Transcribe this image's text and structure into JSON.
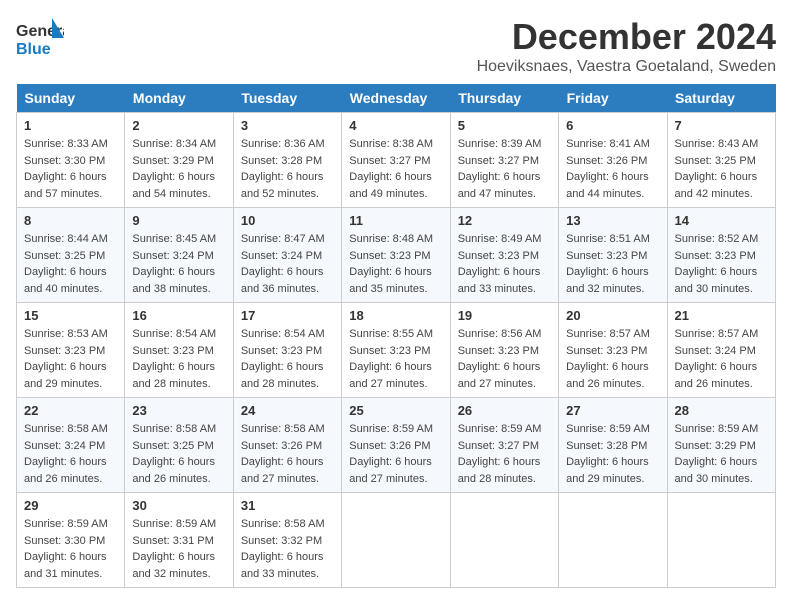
{
  "header": {
    "logo_line1": "General",
    "logo_line2": "Blue",
    "month": "December 2024",
    "location": "Hoeviksnaes, Vaestra Goetaland, Sweden"
  },
  "days_of_week": [
    "Sunday",
    "Monday",
    "Tuesday",
    "Wednesday",
    "Thursday",
    "Friday",
    "Saturday"
  ],
  "weeks": [
    [
      {
        "day": "1",
        "sunrise": "8:33 AM",
        "sunset": "3:30 PM",
        "daylight": "6 hours and 57 minutes."
      },
      {
        "day": "2",
        "sunrise": "8:34 AM",
        "sunset": "3:29 PM",
        "daylight": "6 hours and 54 minutes."
      },
      {
        "day": "3",
        "sunrise": "8:36 AM",
        "sunset": "3:28 PM",
        "daylight": "6 hours and 52 minutes."
      },
      {
        "day": "4",
        "sunrise": "8:38 AM",
        "sunset": "3:27 PM",
        "daylight": "6 hours and 49 minutes."
      },
      {
        "day": "5",
        "sunrise": "8:39 AM",
        "sunset": "3:27 PM",
        "daylight": "6 hours and 47 minutes."
      },
      {
        "day": "6",
        "sunrise": "8:41 AM",
        "sunset": "3:26 PM",
        "daylight": "6 hours and 44 minutes."
      },
      {
        "day": "7",
        "sunrise": "8:43 AM",
        "sunset": "3:25 PM",
        "daylight": "6 hours and 42 minutes."
      }
    ],
    [
      {
        "day": "8",
        "sunrise": "8:44 AM",
        "sunset": "3:25 PM",
        "daylight": "6 hours and 40 minutes."
      },
      {
        "day": "9",
        "sunrise": "8:45 AM",
        "sunset": "3:24 PM",
        "daylight": "6 hours and 38 minutes."
      },
      {
        "day": "10",
        "sunrise": "8:47 AM",
        "sunset": "3:24 PM",
        "daylight": "6 hours and 36 minutes."
      },
      {
        "day": "11",
        "sunrise": "8:48 AM",
        "sunset": "3:23 PM",
        "daylight": "6 hours and 35 minutes."
      },
      {
        "day": "12",
        "sunrise": "8:49 AM",
        "sunset": "3:23 PM",
        "daylight": "6 hours and 33 minutes."
      },
      {
        "day": "13",
        "sunrise": "8:51 AM",
        "sunset": "3:23 PM",
        "daylight": "6 hours and 32 minutes."
      },
      {
        "day": "14",
        "sunrise": "8:52 AM",
        "sunset": "3:23 PM",
        "daylight": "6 hours and 30 minutes."
      }
    ],
    [
      {
        "day": "15",
        "sunrise": "8:53 AM",
        "sunset": "3:23 PM",
        "daylight": "6 hours and 29 minutes."
      },
      {
        "day": "16",
        "sunrise": "8:54 AM",
        "sunset": "3:23 PM",
        "daylight": "6 hours and 28 minutes."
      },
      {
        "day": "17",
        "sunrise": "8:54 AM",
        "sunset": "3:23 PM",
        "daylight": "6 hours and 28 minutes."
      },
      {
        "day": "18",
        "sunrise": "8:55 AM",
        "sunset": "3:23 PM",
        "daylight": "6 hours and 27 minutes."
      },
      {
        "day": "19",
        "sunrise": "8:56 AM",
        "sunset": "3:23 PM",
        "daylight": "6 hours and 27 minutes."
      },
      {
        "day": "20",
        "sunrise": "8:57 AM",
        "sunset": "3:23 PM",
        "daylight": "6 hours and 26 minutes."
      },
      {
        "day": "21",
        "sunrise": "8:57 AM",
        "sunset": "3:24 PM",
        "daylight": "6 hours and 26 minutes."
      }
    ],
    [
      {
        "day": "22",
        "sunrise": "8:58 AM",
        "sunset": "3:24 PM",
        "daylight": "6 hours and 26 minutes."
      },
      {
        "day": "23",
        "sunrise": "8:58 AM",
        "sunset": "3:25 PM",
        "daylight": "6 hours and 26 minutes."
      },
      {
        "day": "24",
        "sunrise": "8:58 AM",
        "sunset": "3:26 PM",
        "daylight": "6 hours and 27 minutes."
      },
      {
        "day": "25",
        "sunrise": "8:59 AM",
        "sunset": "3:26 PM",
        "daylight": "6 hours and 27 minutes."
      },
      {
        "day": "26",
        "sunrise": "8:59 AM",
        "sunset": "3:27 PM",
        "daylight": "6 hours and 28 minutes."
      },
      {
        "day": "27",
        "sunrise": "8:59 AM",
        "sunset": "3:28 PM",
        "daylight": "6 hours and 29 minutes."
      },
      {
        "day": "28",
        "sunrise": "8:59 AM",
        "sunset": "3:29 PM",
        "daylight": "6 hours and 30 minutes."
      }
    ],
    [
      {
        "day": "29",
        "sunrise": "8:59 AM",
        "sunset": "3:30 PM",
        "daylight": "6 hours and 31 minutes."
      },
      {
        "day": "30",
        "sunrise": "8:59 AM",
        "sunset": "3:31 PM",
        "daylight": "6 hours and 32 minutes."
      },
      {
        "day": "31",
        "sunrise": "8:58 AM",
        "sunset": "3:32 PM",
        "daylight": "6 hours and 33 minutes."
      },
      null,
      null,
      null,
      null
    ]
  ],
  "labels": {
    "sunrise": "Sunrise:",
    "sunset": "Sunset:",
    "daylight": "Daylight:"
  }
}
